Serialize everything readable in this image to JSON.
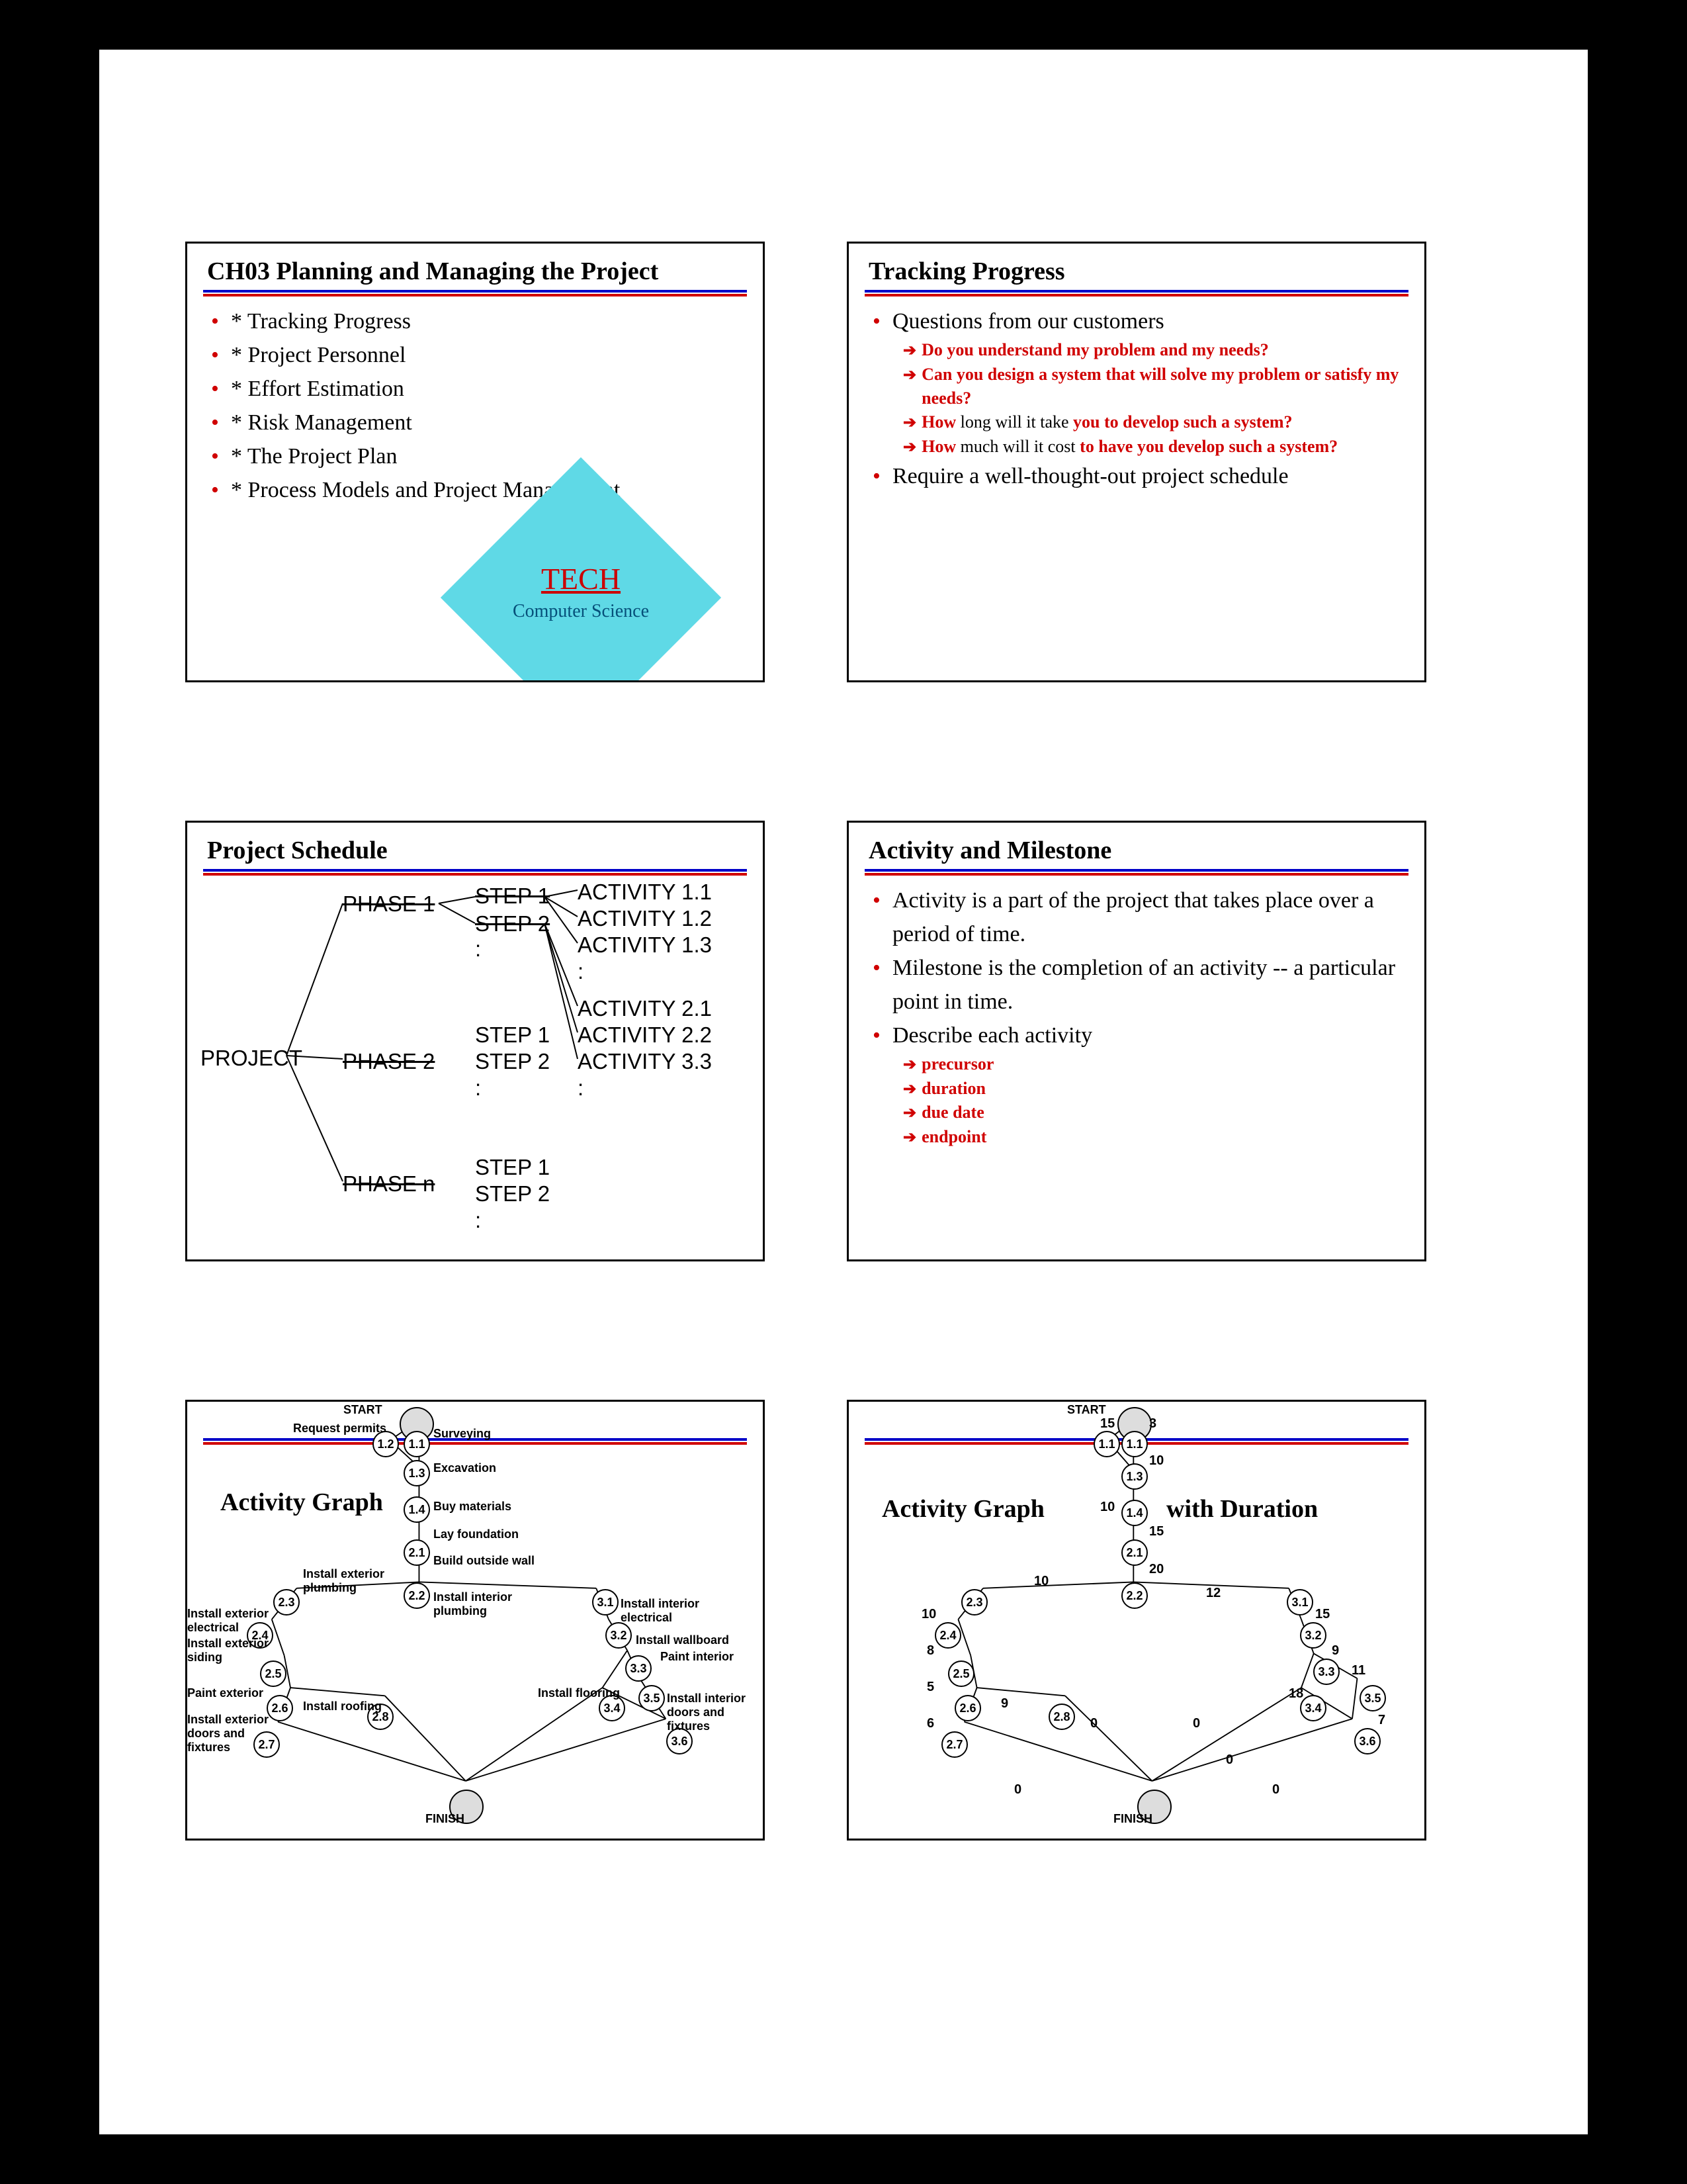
{
  "slide1": {
    "title": "CH03 Planning and Managing the Project",
    "items": [
      "* Tracking Progress",
      "* Project Personnel",
      "* Effort Estimation",
      "* Risk Management",
      "* The Project Plan",
      "* Process Models and Project Management"
    ],
    "logo": {
      "main": "TECH",
      "sub": "Computer Science"
    }
  },
  "slide2": {
    "title": "Tracking Progress",
    "item1": "Questions from our customers",
    "subs": [
      "Do you understand my problem and my needs?",
      "Can you design a system that will solve my problem or satisfy my needs?",
      "How long will it take you to develop such a system?",
      "How much will it cost to have you develop such a system?"
    ],
    "sub3_prefix": "How",
    "sub3_plain": " long will it take ",
    "sub3_bold2": "you to develop such a system?",
    "sub4_prefix": "How",
    "sub4_plain": " much will it cost ",
    "sub4_bold2": "to have you develop such a system?",
    "item2": "Require a well-thought-out project schedule"
  },
  "slide3": {
    "title": "Project Schedule",
    "labels": {
      "project": "PROJECT",
      "phase1": "PHASE 1",
      "phase2": "PHASE 2",
      "phasen": "PHASE n",
      "step1": "STEP 1",
      "step2": "STEP 2",
      "colon": ":",
      "a11": "ACTIVITY 1.1",
      "a12": "ACTIVITY 1.2",
      "a13": "ACTIVITY 1.3",
      "a21": "ACTIVITY 2.1",
      "a22": "ACTIVITY 2.2",
      "a33": "ACTIVITY 3.3"
    }
  },
  "slide4": {
    "title": "Activity and Milestone",
    "items": [
      "Activity is a part of the project that takes place over a period of time.",
      "Milestone is the completion of an activity -- a particular point in time.",
      "Describe each activity"
    ],
    "subs": [
      "precursor",
      "duration",
      "due date",
      "endpoint"
    ]
  },
  "slide5": {
    "title": "Activity Graph",
    "labels": {
      "start": "START",
      "finish": "FINISH",
      "reqperm": "Request permits",
      "survey": "Surveying",
      "excav": "Excavation",
      "buymat": "Buy materials",
      "layfound": "Lay foundation",
      "buildwall": "Build outside wall",
      "extplumb": "Install exterior plumbing",
      "intplumb": "Install interior plumbing",
      "extelec": "Install exterior electrical",
      "intelec": "Install interior electrical",
      "extsiding": "Install exterior siding",
      "paint_ext": "Paint exterior",
      "extdoors": "Install exterior doors and fixtures",
      "roofing": "Install roofing",
      "wallboard": "Install wallboard",
      "paintint": "Paint interior",
      "flooring": "Install flooring",
      "intdoors": "Install interior doors and fixtures"
    },
    "nodes": [
      "1.1",
      "1.2",
      "1.3",
      "1.4",
      "2.1",
      "2.2",
      "2.3",
      "2.4",
      "2.5",
      "2.6",
      "2.7",
      "2.8",
      "3.1",
      "3.2",
      "3.3",
      "3.4",
      "3.5",
      "3.6"
    ]
  },
  "slide6": {
    "title_left": "Activity Graph",
    "title_right": "with Duration",
    "labels": {
      "start": "START",
      "finish": "FINISH"
    },
    "node_ids": [
      "1.1",
      "1.3",
      "1.4",
      "2.1",
      "2.2",
      "2.3",
      "2.4",
      "2.5",
      "2.6",
      "2.7",
      "2.8",
      "3.1",
      "3.2",
      "3.3",
      "3.4",
      "3.5",
      "3.6"
    ],
    "weights": {
      "w_start_left": "15",
      "w_start_right": "3",
      "w_11_13": "10",
      "w_13_14": "10",
      "w_14_21": "15",
      "w_21_22": "20",
      "w_22_23": "10",
      "w_22_31": "12",
      "w_23_24": "10",
      "w_31_32": "15",
      "w_24_25": "8",
      "w_32_33": "9",
      "w_25_26": "5",
      "w_33_35": "11",
      "w_33_34": "18",
      "w_26_27": "6",
      "w_26_28": "9",
      "w_35_36": "7",
      "w_27_fin": "0",
      "w_28_fin_a": "0",
      "w_28_fin_b": "0",
      "w_36_fin": "0",
      "w_34_fin": "0"
    }
  }
}
